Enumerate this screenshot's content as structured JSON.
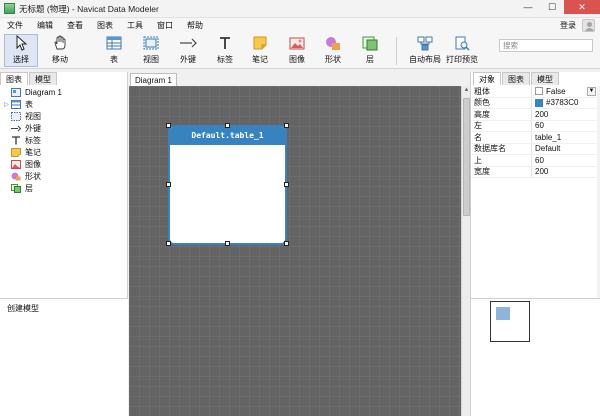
{
  "window": {
    "title": "无标题 (物理) - Navicat Data Modeler",
    "minimize": "—",
    "maximize": "☐",
    "close": "✕"
  },
  "menu": [
    "文件",
    "编辑",
    "查看",
    "图表",
    "工具",
    "窗口",
    "帮助"
  ],
  "login_label": "登录",
  "toolbar": {
    "select": "选择",
    "move": "移动",
    "table": "表",
    "view": "视图",
    "foreign_key": "外键",
    "label": "标签",
    "note": "笔记",
    "image": "图像",
    "shape": "形状",
    "layer": "层",
    "auto_layout": "自动布局",
    "print_preview": "打印预览"
  },
  "search": {
    "placeholder": "搜索"
  },
  "left_tabs": [
    "图表",
    "模型"
  ],
  "tree": {
    "diagram": "Diagram 1",
    "items": [
      "表",
      "视图",
      "外键",
      "标签",
      "笔记",
      "图像",
      "形状",
      "层"
    ]
  },
  "left_bottom_text": "创建模型",
  "doc_tab": "Diagram 1",
  "entity": {
    "name": "Default.table_1",
    "color": "#3783C0"
  },
  "right_tabs": [
    "对象",
    "图表",
    "模型"
  ],
  "properties": [
    {
      "key": "粗体",
      "value": "False"
    },
    {
      "key": "颜色",
      "value": "#3783C0"
    },
    {
      "key": "高度",
      "value": "200"
    },
    {
      "key": "左",
      "value": "60"
    },
    {
      "key": "名",
      "value": "table_1"
    },
    {
      "key": "数据库名",
      "value": "Default"
    },
    {
      "key": "上",
      "value": "60"
    },
    {
      "key": "宽度",
      "value": "200"
    }
  ],
  "colors": {
    "accent": "#3783C0",
    "canvas": "#646464",
    "minimap_rect": "#8fb4dc"
  }
}
